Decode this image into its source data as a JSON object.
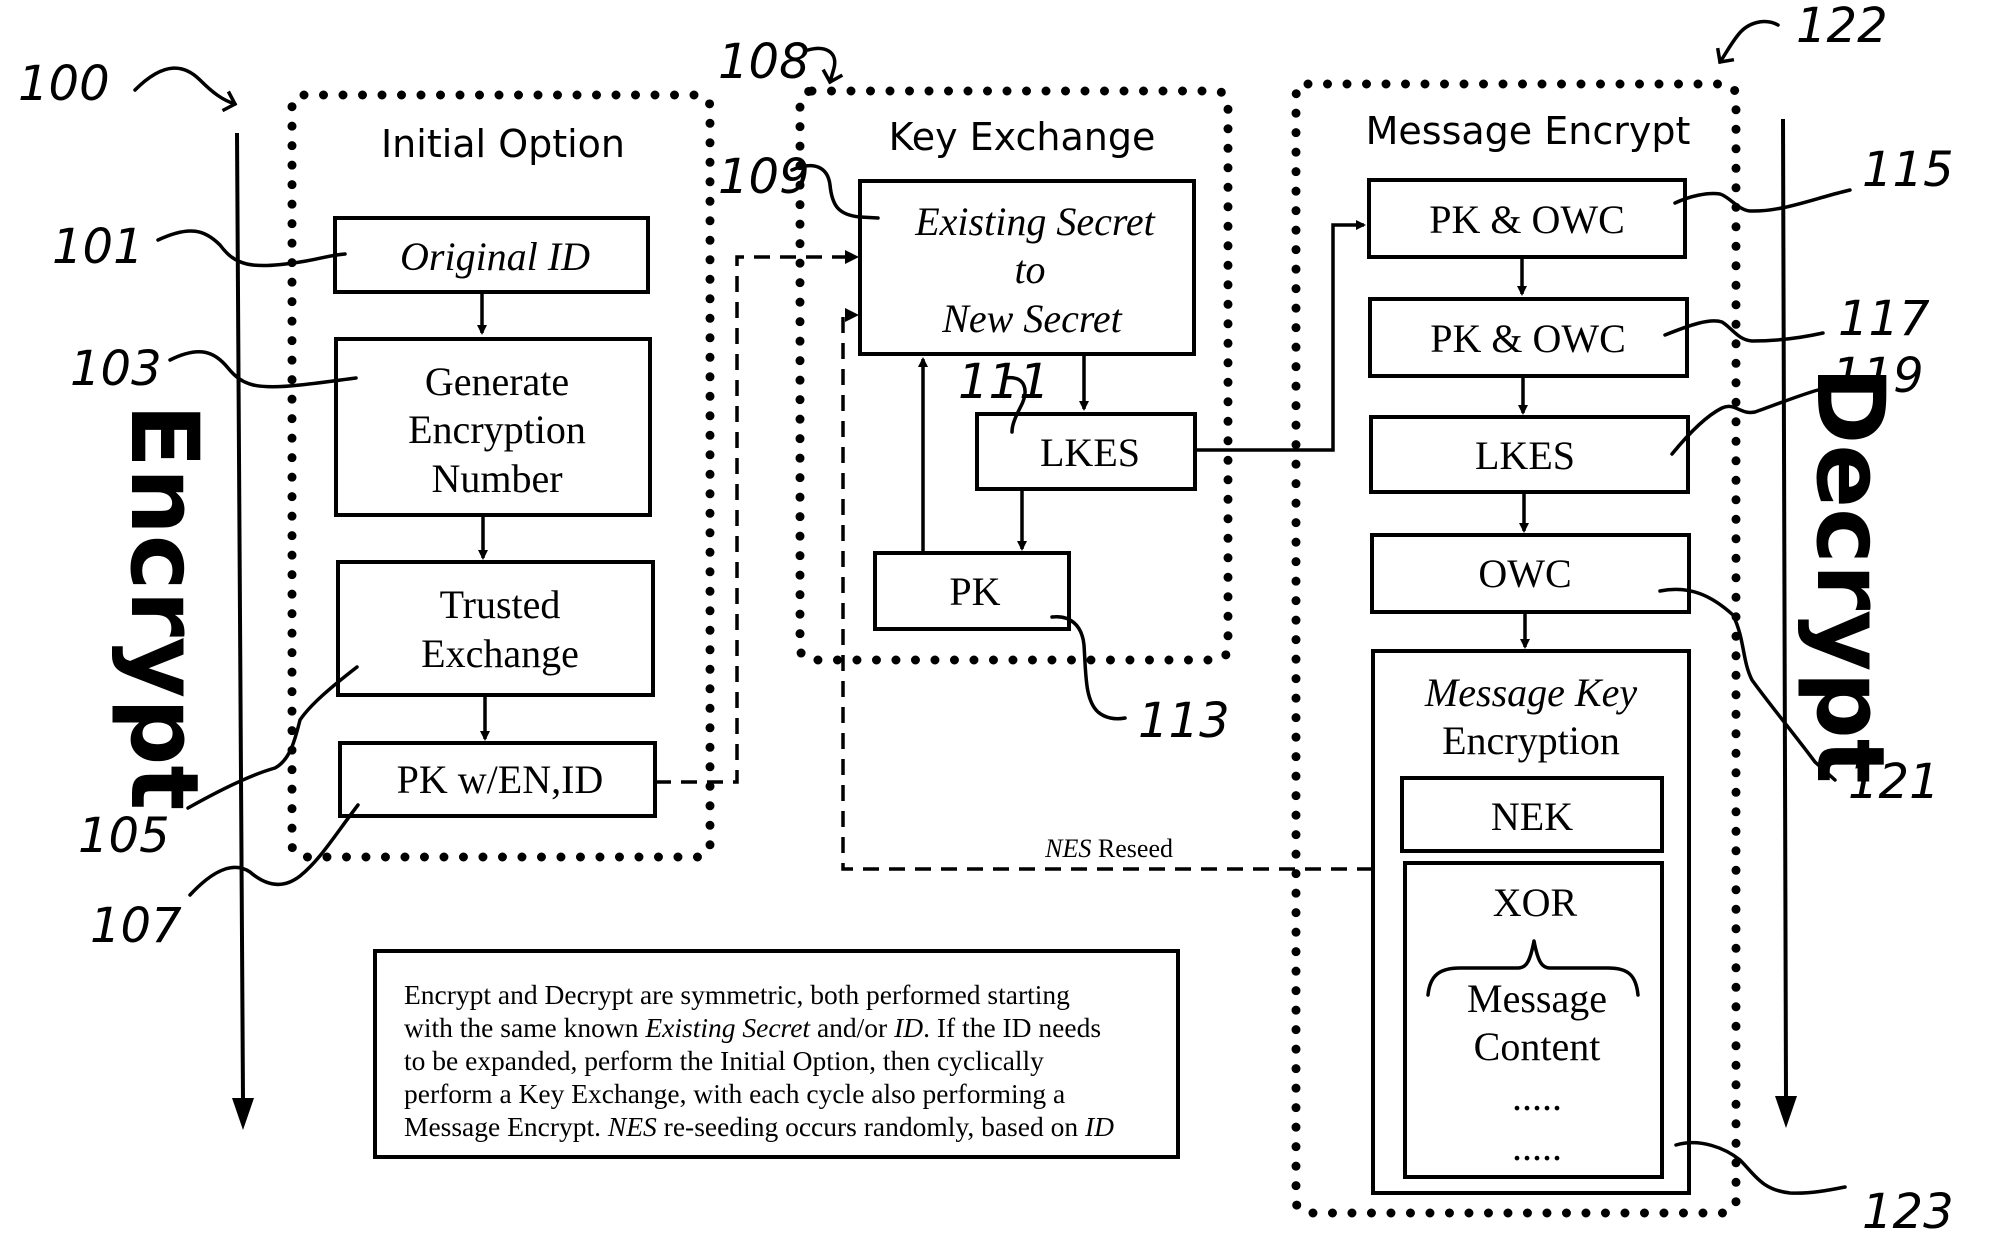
{
  "figure": {
    "side_labels": {
      "encrypt": "Encrypt",
      "decrypt": "Decrypt"
    },
    "reference_numerals": {
      "overall": "100",
      "original_id": "101",
      "generate_encryption_number": "103",
      "trusted_exchange": "105",
      "pk_with_en_id": "107",
      "key_exchange_group": "108",
      "existing_secret": "109",
      "lkes_key_exchange": "111",
      "pk_key_exchange": "113",
      "pk_owc_1": "115",
      "pk_owc_2": "117",
      "lkes_message": "119",
      "owc": "121",
      "message_encrypt_group": "122",
      "message_key_encryption": "123"
    },
    "initial_option": {
      "title": "Initial Option",
      "boxes": {
        "original_id": "Original ID",
        "generate_line1": "Generate",
        "generate_line2": "Encryption",
        "generate_line3": "Number",
        "trusted_line1": "Trusted",
        "trusted_line2": "Exchange",
        "pk_en_id": "PK w/EN,ID"
      }
    },
    "key_exchange": {
      "title": "Key Exchange",
      "boxes": {
        "secret_line1": "Existing Secret",
        "secret_line2": "to",
        "secret_line3": "New Secret",
        "lkes": "LKES",
        "pk": "PK"
      }
    },
    "message_encrypt": {
      "title": "Message Encrypt",
      "boxes": {
        "pk_owc_1": "PK & OWC",
        "pk_owc_2": "PK & OWC",
        "lkes": "LKES",
        "owc": "OWC",
        "mke_line1": "Message Key",
        "mke_line2": "Encryption",
        "nek": "NEK",
        "xor": "XOR",
        "content_line1": "Message",
        "content_line2": "Content",
        "ellipsis_1": ".....",
        "ellipsis_2": "....."
      }
    },
    "reseed_label": {
      "italic": "NES",
      "rest": " Reseed"
    },
    "note": {
      "line1": "Encrypt and Decrypt are symmetric, both performed starting",
      "line2_a": "with the same known ",
      "line2_b": "Existing Secret",
      "line2_c": " and/or ",
      "line2_d": "ID",
      "line2_e": ". If the ID needs",
      "line3": "to be expanded, perform the Initial Option, then cyclically",
      "line4": "perform a Key Exchange, with each cycle also performing a",
      "line5_a": "Message Encrypt. ",
      "line5_b": "NES",
      "line5_c": " re-seeding occurs randomly, based on ",
      "line5_d": "ID"
    }
  }
}
